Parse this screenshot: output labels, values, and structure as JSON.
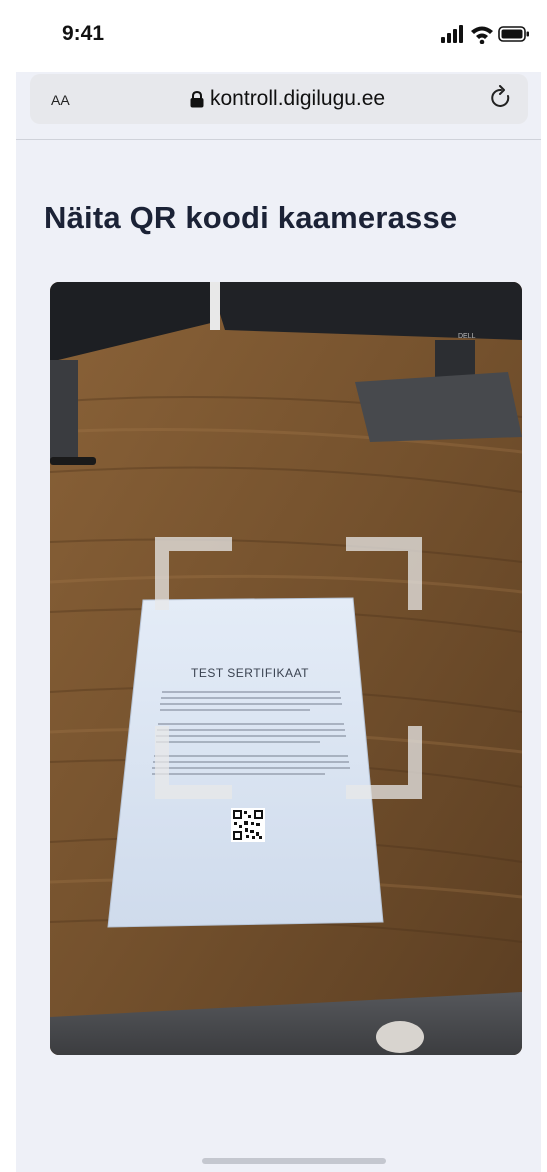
{
  "status": {
    "time": "9:41",
    "icons": [
      "signal-icon",
      "wifi-icon",
      "battery-icon"
    ]
  },
  "browser": {
    "text_size_label": "AA",
    "url": "kontroll.digilugu.ee",
    "icons": [
      "lock-icon",
      "reload-icon"
    ]
  },
  "page": {
    "title": "Näita QR koodi kaamerasse"
  },
  "camera": {
    "document_title": "TEST SERTIFIKAAT",
    "monitor_brand": "DELL"
  },
  "colors": {
    "page_background": "#eef0f7",
    "title_text": "#1b2236",
    "url_bar": "#e7e8ec"
  }
}
